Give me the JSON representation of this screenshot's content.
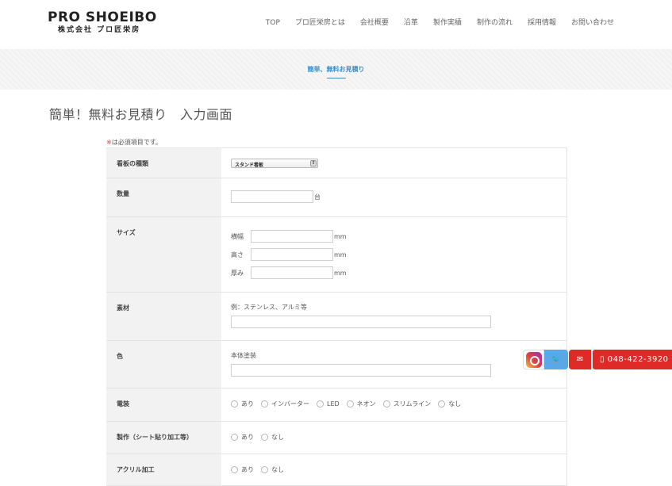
{
  "header": {
    "logo_main": "PRO SHOEIBO",
    "logo_sub": "株式会社 プロ匠栄房",
    "nav": [
      "TOP",
      "プロ匠栄房とは",
      "会社概要",
      "沿革",
      "製作実績",
      "制作の流れ",
      "採用情報",
      "お問い合わせ"
    ]
  },
  "band": {
    "title": "簡単、無料お見積り"
  },
  "page": {
    "title": "簡単！無料お見積り　入力画面",
    "required_mark": "※",
    "required_text": "は必須項目です。"
  },
  "form": {
    "type": {
      "label": "看板の種類",
      "selected": "スタンド看板"
    },
    "quantity": {
      "label": "数量",
      "value": "",
      "unit": "台"
    },
    "size": {
      "label": "サイズ",
      "width_label": "横幅",
      "height_label": "高さ",
      "depth_label": "厚み",
      "unit": "mm"
    },
    "material": {
      "label": "素材",
      "hint": "例：ステンレス、アルミ等",
      "value": ""
    },
    "color": {
      "label": "色",
      "hint": "本体塗装",
      "value": ""
    },
    "electric": {
      "label": "電装",
      "options": [
        "あり",
        "インバーター",
        "LED",
        "ネオン",
        "スリムライン",
        "なし"
      ]
    },
    "production": {
      "label": "製作（シート貼り加工等）",
      "options": [
        "あり",
        "なし"
      ]
    },
    "acrylic": {
      "label": "アクリル加工",
      "options": [
        "あり",
        "なし"
      ]
    }
  },
  "floating": {
    "instagram_icon": "instagram-icon",
    "twitter_icon": "twitter-icon",
    "mail_icon": "mail-icon",
    "phone_icon": "phone-icon",
    "phone": "048-422-3920",
    "colors": {
      "red": "#e02a28",
      "blue": "#59a9e8"
    }
  }
}
